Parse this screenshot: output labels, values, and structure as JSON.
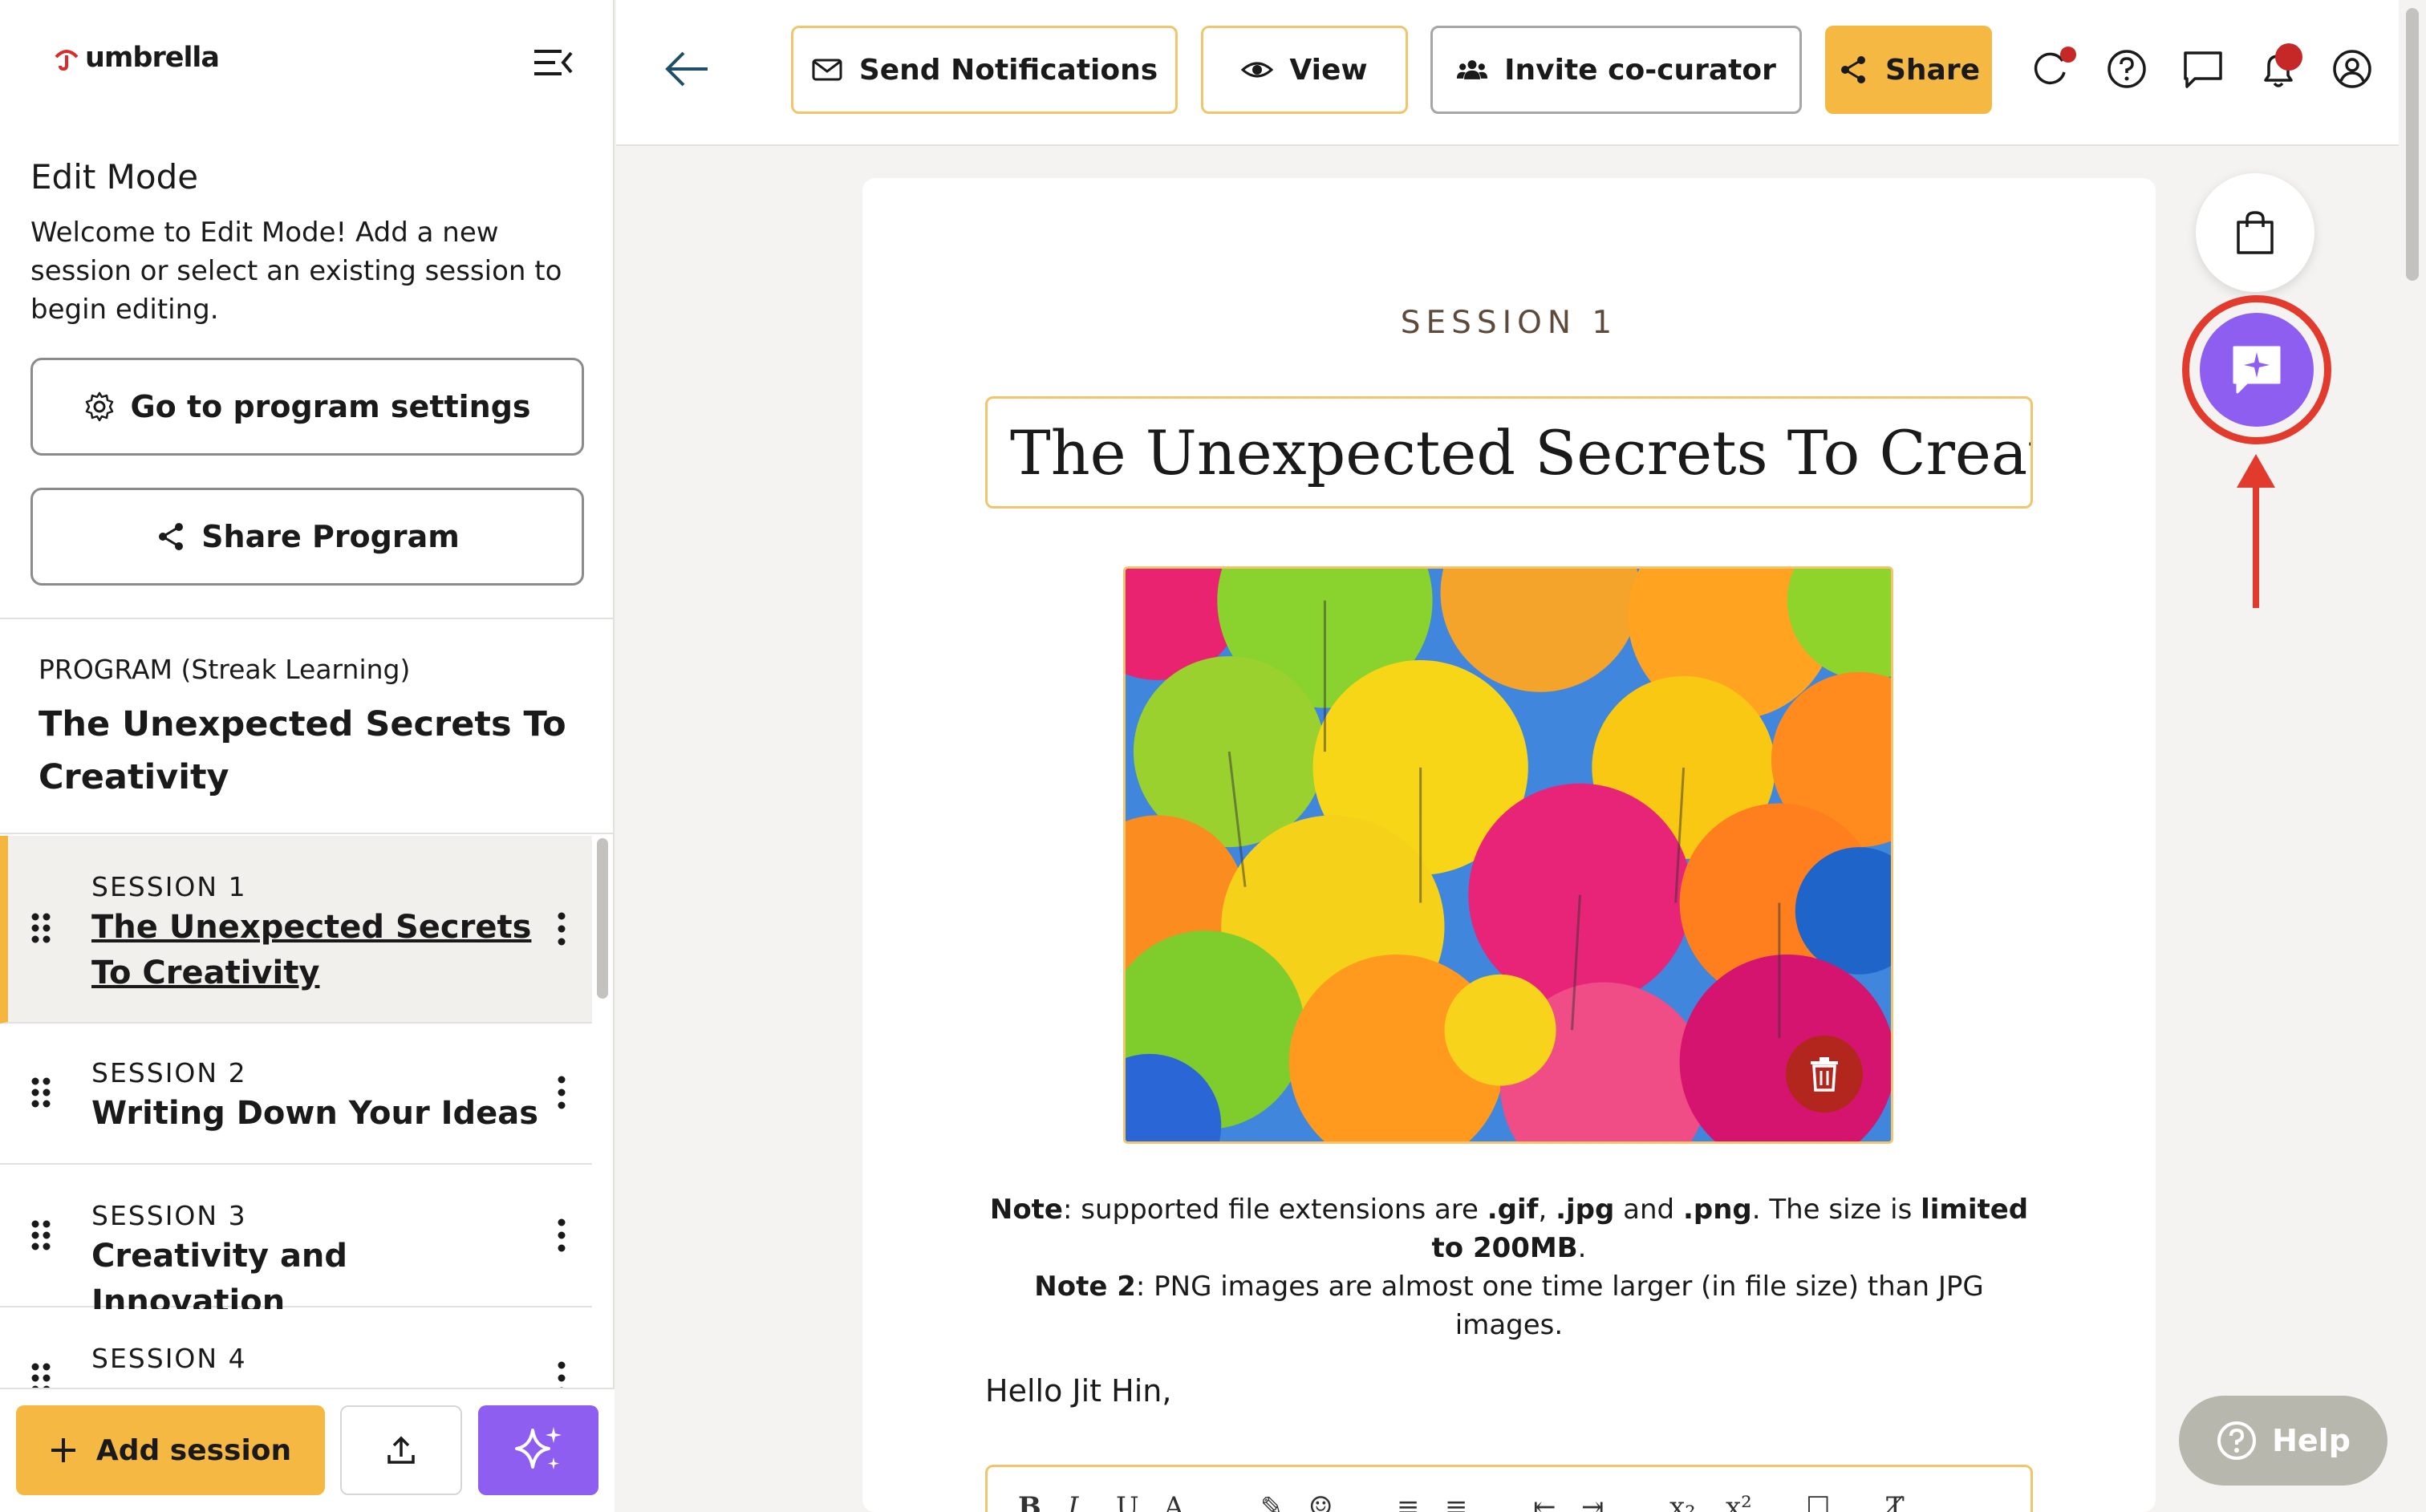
{
  "app": {
    "logo_text": "umbrella"
  },
  "sidebar": {
    "edit_mode_title": "Edit Mode",
    "edit_mode_description": "Welcome to Edit Mode! Add a new session or select an existing session to begin editing.",
    "program_settings_label": "Go to program settings",
    "share_program_label": "Share Program",
    "program_label": "PROGRAM (Streak Learning)",
    "program_title": "The Unexpected Secrets To Creativity",
    "sessions": [
      {
        "number": "SESSION 1",
        "title": "The Unexpected Secrets To Creativity",
        "active": true
      },
      {
        "number": "SESSION 2",
        "title": "Writing Down Your Ideas",
        "active": false
      },
      {
        "number": "SESSION 3",
        "title": "Creativity and Innovation",
        "active": false
      },
      {
        "number": "SESSION 4",
        "title": "",
        "active": false
      }
    ],
    "add_session_label": "Add session"
  },
  "topbar": {
    "send_notifications_label": "Send Notifications",
    "view_label": "View",
    "invite_label": "Invite co-curator",
    "share_label": "Share"
  },
  "main": {
    "session_label": "SESSION 1",
    "title_value": "The Unexpected Secrets To Creativity",
    "note": {
      "n1_label": "Note",
      "n1_text_a": ": supported file extensions are ",
      "ext_gif": ".gif",
      "sep1": ", ",
      "ext_jpg": ".jpg",
      "sep2": " and ",
      "ext_png": ".png",
      "n1_text_b": ". The size is ",
      "limit": "limited to 200MB",
      "period": ".",
      "n2_label": "Note 2",
      "n2_text": ": PNG images are almost one time larger (in file size) than JPG images."
    },
    "greeting": "Hello Jit Hin,"
  },
  "help": {
    "label": "Help"
  },
  "colors": {
    "accent_yellow": "#f5b843",
    "ai_purple": "#8d5ef0",
    "highlight_red": "#e23b2e",
    "delete_red": "#b3261e"
  },
  "icons": [
    "menu-collapse-icon",
    "gear-icon",
    "share-icon",
    "drag-handle-icon",
    "kebab-icon",
    "plus-icon",
    "upload-icon",
    "sparkles-icon",
    "arrow-left-icon",
    "envelope-icon",
    "eye-icon",
    "users-icon",
    "refresh-icon",
    "help-circle-icon",
    "chat-icon",
    "bell-icon",
    "user-circle-icon",
    "shopping-bag-icon",
    "chat-sparkle-icon",
    "trash-icon"
  ]
}
